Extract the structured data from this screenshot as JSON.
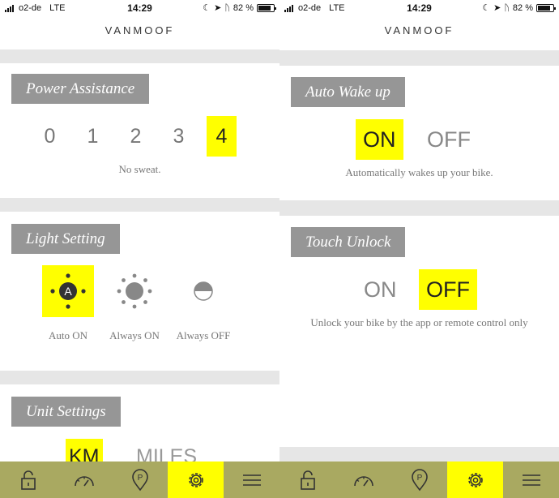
{
  "left": {
    "status": {
      "carrier": "o2-de",
      "network": "LTE",
      "time": "14:29",
      "battery": "82 %",
      "battery_level": 0.82
    },
    "brand": "VANMOOF",
    "power": {
      "title": "Power Assistance",
      "levels": [
        "0",
        "1",
        "2",
        "3",
        "4"
      ],
      "selected": "4",
      "caption": "No sweat."
    },
    "light": {
      "title": "Light Setting",
      "options": [
        {
          "label": "Auto ON",
          "icon": "auto-light-icon",
          "glyph": "A",
          "selected": true
        },
        {
          "label": "Always ON",
          "icon": "sun-icon",
          "selected": false
        },
        {
          "label": "Always OFF",
          "icon": "half-circle-icon",
          "selected": false
        }
      ]
    },
    "units": {
      "title": "Unit Settings",
      "km": "KM",
      "miles": "MILES",
      "selected": "KM"
    },
    "tabs": [
      "lock-icon",
      "speedometer-icon",
      "parking-pin-icon",
      "gear-icon",
      "menu-icon"
    ],
    "selected_tab": "gear-icon"
  },
  "right": {
    "status": {
      "carrier": "o2-de",
      "network": "LTE",
      "time": "14:29",
      "battery": "82 %",
      "battery_level": 0.82
    },
    "brand": "VANMOOF",
    "wake": {
      "title": "Auto Wake up",
      "on": "ON",
      "off": "OFF",
      "selected": "ON",
      "caption": "Automatically wakes up your bike."
    },
    "touch": {
      "title": "Touch Unlock",
      "on": "ON",
      "off": "OFF",
      "selected": "OFF",
      "caption": "Unlock your bike by the app or remote control only"
    },
    "tabs": [
      "lock-icon",
      "speedometer-icon",
      "parking-pin-icon",
      "gear-icon",
      "menu-icon"
    ],
    "selected_tab": "gear-icon"
  },
  "colors": {
    "highlight": "#ffff00",
    "tabbar": "#a9a961",
    "title_bg": "#969696",
    "gap": "#e6e6e6"
  }
}
